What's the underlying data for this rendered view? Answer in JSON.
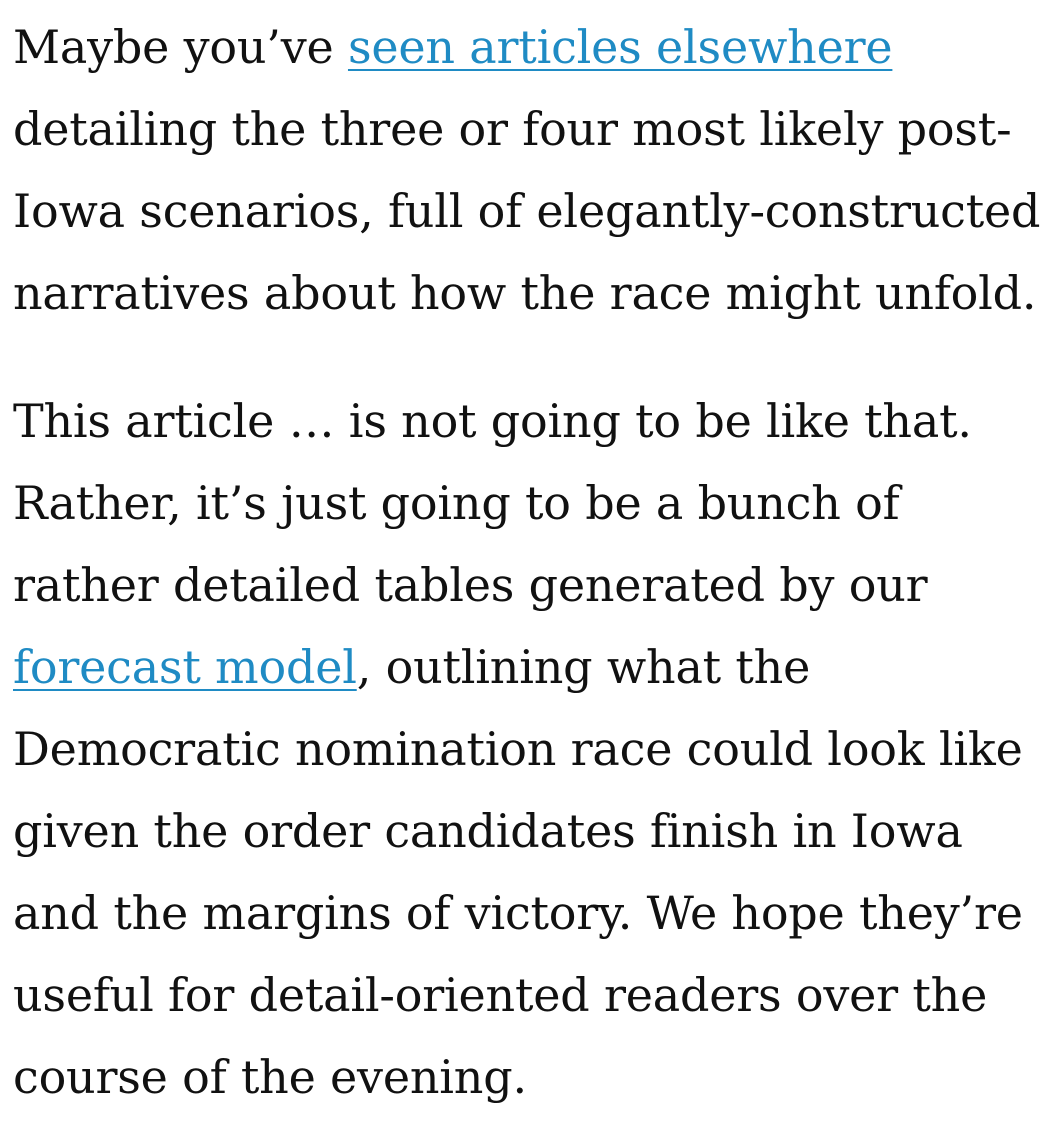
{
  "paragraph1": {
    "intro": "Maybe you’ve ",
    "link_text": "seen articles elsewhere",
    "lines": [
      "detailing the three or four most likely post-",
      "Iowa scenarios, full of elegantly-constructed",
      "narratives about how the race might unfold."
    ]
  },
  "paragraph2": {
    "lines_before": [
      "This article … is not going to be like that.",
      "Rather, it’s just going to be a bunch of",
      "rather detailed tables generated by our"
    ],
    "link_text": "forecast model",
    "after_link": ", outlining what the",
    "lines_after": [
      "Democratic nomination race could look like",
      "given the order candidates finish in Iowa",
      "and the margins of victory. We hope they’re",
      "useful for detail-oriented readers over the",
      "course of the evening."
    ]
  },
  "colors": {
    "text": "#111111",
    "link": "#1f8bc4",
    "background": "#ffffff"
  }
}
